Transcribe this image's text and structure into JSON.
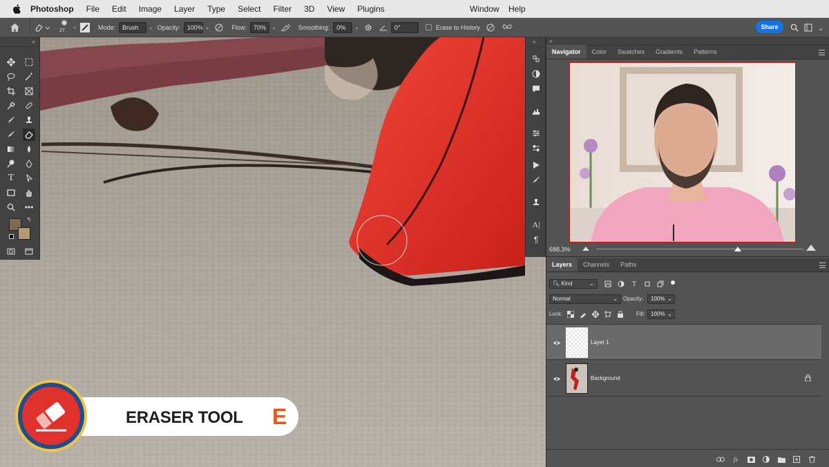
{
  "menubar": {
    "app_name": "Photoshop",
    "items": [
      "File",
      "Edit",
      "Image",
      "Layer",
      "Type",
      "Select",
      "Filter",
      "3D",
      "View",
      "Plugins"
    ],
    "right_items": [
      "Window",
      "Help"
    ]
  },
  "options": {
    "brush_size": "27",
    "mode_label": "Mode:",
    "mode_value": "Brush",
    "opacity_label": "Opacity:",
    "opacity_value": "100%",
    "flow_label": "Flow:",
    "flow_value": "70%",
    "smoothing_label": "Smoothing:",
    "smoothing_value": "0%",
    "angle_value": "0°",
    "erase_history_label": "Erase to History",
    "share_label": "Share"
  },
  "navigator": {
    "tabs": [
      "Navigator",
      "Color",
      "Swatches",
      "Gradients",
      "Patterns"
    ],
    "zoom": "688.3%"
  },
  "layers": {
    "tabs": [
      "Layers",
      "Channels",
      "Paths"
    ],
    "kind_label": "Kind",
    "blend_mode": "Normal",
    "opacity_label": "Opacity:",
    "opacity_value": "100%",
    "lock_label": "Lock:",
    "fill_label": "Fill:",
    "fill_value": "100%",
    "rows": [
      {
        "name": "Layer 1"
      },
      {
        "name": "Background"
      }
    ]
  },
  "overlay": {
    "tool_name": "ERASER TOOL",
    "shortcut": "E"
  },
  "colors": {
    "accent_blue": "#1473e6",
    "badge_red": "#e0312c",
    "badge_blue": "#1d4f8f",
    "badge_gold": "#f1c542",
    "shortcut_orange": "#e65816"
  }
}
